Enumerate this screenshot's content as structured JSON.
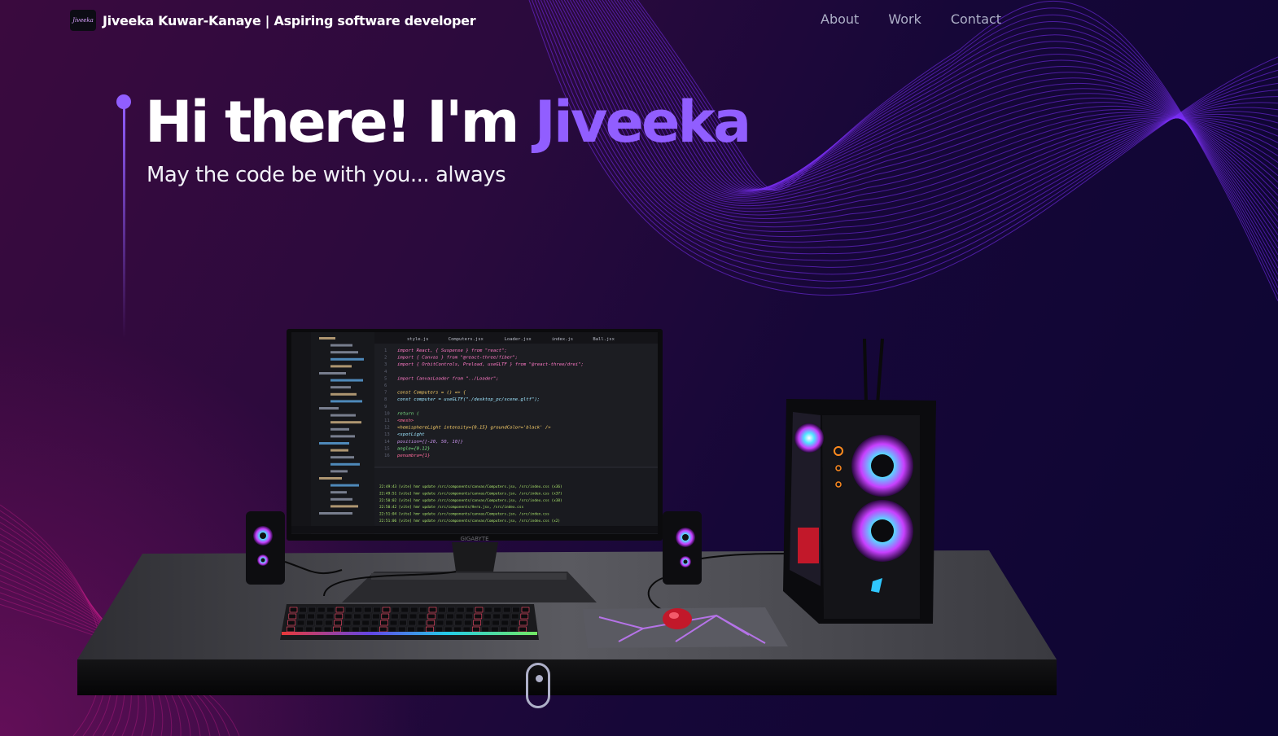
{
  "nav": {
    "logo_text": "Jiveeka",
    "brand_name": "Jiveeka Kuwar-Kanaye",
    "brand_separator": "|",
    "brand_tagline": "Aspiring software developer",
    "links": [
      {
        "label": "About"
      },
      {
        "label": "Work"
      },
      {
        "label": "Contact"
      }
    ]
  },
  "hero": {
    "greeting": "Hi there! I'm ",
    "name": "Jiveeka",
    "subtitle": "May the code be with you... always"
  },
  "scene": {
    "monitor_brand": "GIGABYTE",
    "editor_tabs": [
      "style.js",
      "Computers.jsx",
      "Loader.jsx",
      "index.js",
      "Ball.jsx"
    ],
    "code_lines": [
      "import React, { Suspense } from \"react\";",
      "import { Canvas } from \"@react-three/fiber\";",
      "import { OrbitControls, Preload, useGLTF } from \"@react-three/drei\";",
      "",
      "import CanvasLoader from \"../Loader\";",
      "",
      "const Computers = () => {",
      "  const computer = useGLTF(\"./desktop_pc/scene.gltf\");",
      "",
      "  return (",
      "    <mesh>",
      "      <hemisphereLight intensity={0.15} groundColor='black' />",
      "      <spotLight",
      "        position={[-20, 50, 10]}",
      "        angle={0.12}",
      "        penumbra={1}"
    ],
    "terminal_lines": [
      "22:49:43 [vite] hmr update /src/components/canvas/Computers.jsx, /src/index.css (x36)",
      "22:49:51 [vite] hmr update /src/components/canvas/Computers.jsx, /src/index.css (x37)",
      "22:50:02 [vite] hmr update /src/components/canvas/Computers.jsx, /src/index.css (x38)",
      "22:50:42 [vite] hmr update /src/components/Hero.jsx, /src/index.css",
      "22:51:04 [vite] hmr update /src/components/canvas/Computers.jsx, /src/index.css",
      "22:51:06 [vite] hmr update /src/components/canvas/Computers.jsx, /src/index.css (x2)",
      "22:51:09 [vite] hmr update /src/components/canvas/Computers.jsx, /src/index.css (x3)"
    ]
  },
  "colors": {
    "accent": "#915eff",
    "text_secondary": "#aeb0c8"
  },
  "icons": {
    "scroll": "mouse-scroll-icon"
  }
}
